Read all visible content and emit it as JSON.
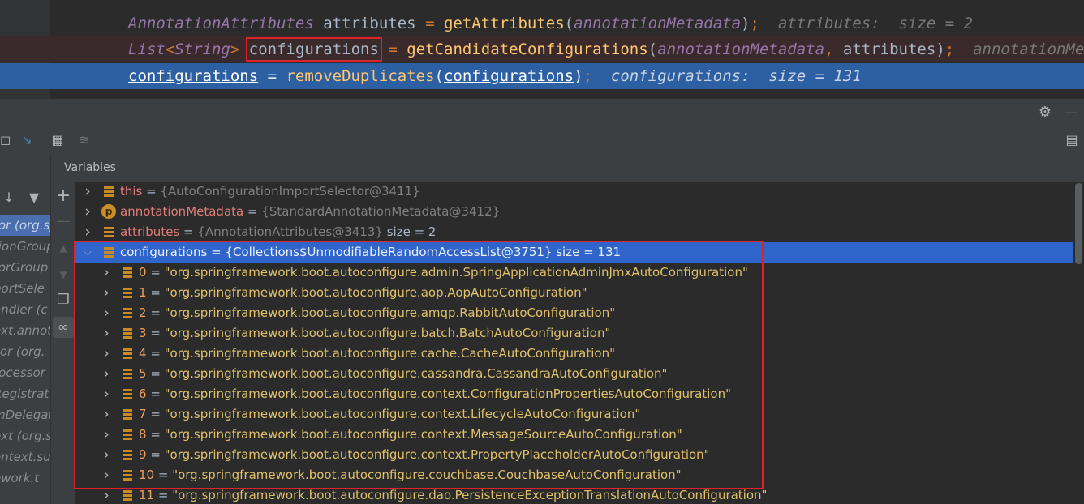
{
  "editor": {
    "line1": {
      "type": "AnnotationAttributes",
      "var": "attributes",
      "eq": " = ",
      "fn": "getAttributes",
      "arg": "annotationMetadata",
      "inline": "attributes:  size = 2"
    },
    "line2": {
      "type": "List",
      "generic_open": "<",
      "generic_type": "String",
      "generic_close": ">",
      "var": "configurations",
      "eq": " = ",
      "fn": "getCandidateConfigurations",
      "arg1": "annotationMetadata",
      "arg2": "attributes",
      "inline": "annotationMetadata"
    },
    "line3": {
      "var": "configurations",
      "eq": " = ",
      "fn": "removeDuplicates",
      "arg": "configurations",
      "inline": "configurations:  size = 131"
    }
  },
  "panel": {
    "variables_title": "Variables",
    "settings_icon": "gear-icon",
    "minimize_icon": "minimize-icon"
  },
  "frames": [
    {
      "label": "tor (org.sp",
      "selected": true
    },
    {
      "label": "tionGroup"
    },
    {
      "label": "torGroup"
    },
    {
      "label": "portSele"
    },
    {
      "label": "andler (c"
    },
    {
      "label": "ext.annota"
    },
    {
      "label": "sor (org."
    },
    {
      "label": "rocessor"
    },
    {
      "label": "Registrat"
    },
    {
      "label": "mDelegat"
    },
    {
      "label": "ext (org.s"
    },
    {
      "label": "ontext.su"
    },
    {
      "label": "ework.t"
    }
  ],
  "variables": [
    {
      "name": "this",
      "eq": " = ",
      "type": "{AutoConfigurationImportSelector@3411}",
      "size": ""
    },
    {
      "name": "annotationMetadata",
      "eq": " = ",
      "type": "{StandardAnnotationMetadata@3412}",
      "size": ""
    },
    {
      "name": "attributes",
      "eq": " = ",
      "type": "{AnnotationAttributes@3413}",
      "size": "size = 2"
    },
    {
      "name": "configurations",
      "eq": " = ",
      "type": "{Collections$UnmodifiableRandomAccessList@3751}",
      "size": "size = 131"
    }
  ],
  "children": [
    {
      "idx": "0",
      "eq": " = ",
      "value": "\"org.springframework.boot.autoconfigure.admin.SpringApplicationAdminJmxAutoConfiguration\""
    },
    {
      "idx": "1",
      "eq": " = ",
      "value": "\"org.springframework.boot.autoconfigure.aop.AopAutoConfiguration\""
    },
    {
      "idx": "2",
      "eq": " = ",
      "value": "\"org.springframework.boot.autoconfigure.amqp.RabbitAutoConfiguration\""
    },
    {
      "idx": "3",
      "eq": " = ",
      "value": "\"org.springframework.boot.autoconfigure.batch.BatchAutoConfiguration\""
    },
    {
      "idx": "4",
      "eq": " = ",
      "value": "\"org.springframework.boot.autoconfigure.cache.CacheAutoConfiguration\""
    },
    {
      "idx": "5",
      "eq": " = ",
      "value": "\"org.springframework.boot.autoconfigure.cassandra.CassandraAutoConfiguration\""
    },
    {
      "idx": "6",
      "eq": " = ",
      "value": "\"org.springframework.boot.autoconfigure.context.ConfigurationPropertiesAutoConfiguration\""
    },
    {
      "idx": "7",
      "eq": " = ",
      "value": "\"org.springframework.boot.autoconfigure.context.LifecycleAutoConfiguration\""
    },
    {
      "idx": "8",
      "eq": " = ",
      "value": "\"org.springframework.boot.autoconfigure.context.MessageSourceAutoConfiguration\""
    },
    {
      "idx": "9",
      "eq": " = ",
      "value": "\"org.springframework.boot.autoconfigure.context.PropertyPlaceholderAutoConfiguration\""
    },
    {
      "idx": "10",
      "eq": " = ",
      "value": "\"org.springframework.boot.autoconfigure.couchbase.CouchbaseAutoConfiguration\""
    },
    {
      "idx": "11",
      "eq": " = ",
      "value": "\"org.springframework.boot.autoconfigure.dao.PersistenceExceptionTranslationAutoConfiguration\""
    }
  ]
}
